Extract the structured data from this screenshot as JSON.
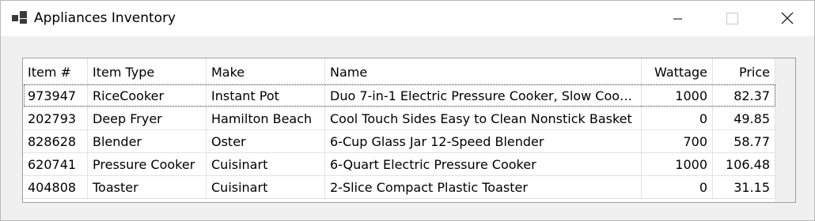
{
  "window": {
    "title": "Appliances Inventory",
    "icon": "app-window-icon",
    "controls": [
      "minimize-icon",
      "maximize-icon",
      "close-icon"
    ]
  },
  "grid": {
    "columns": [
      {
        "label": "Item #",
        "align": "left"
      },
      {
        "label": "Item Type",
        "align": "left"
      },
      {
        "label": "Make",
        "align": "left"
      },
      {
        "label": "Name",
        "align": "left"
      },
      {
        "label": "Wattage",
        "align": "right"
      },
      {
        "label": "Price",
        "align": "right"
      }
    ],
    "rows": [
      {
        "item": "973947",
        "type": "RiceCooker",
        "make": "Instant Pot",
        "name": "Duo 7-in-1 Electric Pressure Cooker, Slow Cook...",
        "wattage": "1000",
        "price": "82.37"
      },
      {
        "item": "202793",
        "type": "Deep Fryer",
        "make": "Hamilton Beach",
        "name": "Cool Touch Sides Easy to Clean Nonstick Basket",
        "wattage": "0",
        "price": "49.85"
      },
      {
        "item": "828628",
        "type": "Blender",
        "make": "Oster",
        "name": "6-Cup Glass Jar 12-Speed Blender",
        "wattage": "700",
        "price": "58.77"
      },
      {
        "item": "620741",
        "type": "Pressure Cooker",
        "make": "Cuisinart",
        "name": "6-Quart Electric Pressure Cooker",
        "wattage": "1000",
        "price": "106.48"
      },
      {
        "item": "404808",
        "type": "Toaster",
        "make": "Cuisinart",
        "name": "2-Slice Compact Plastic Toaster",
        "wattage": "0",
        "price": "31.15"
      }
    ]
  }
}
